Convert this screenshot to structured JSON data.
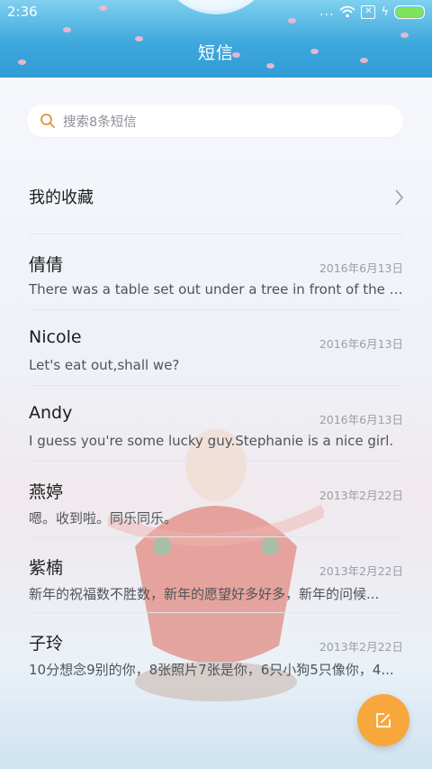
{
  "status_bar": {
    "time": "2:36",
    "signal": "...",
    "battery_color": "#7ee35c"
  },
  "header": {
    "title": "短信",
    "color": "#3fa8dc"
  },
  "search": {
    "placeholder": "搜索8条短信"
  },
  "favorites": {
    "label": "我的收藏"
  },
  "conversations": [
    {
      "name": "倩倩",
      "date": "2016年6月13日",
      "preview": "There was a table set out under a tree in front of the ho..."
    },
    {
      "name": "Nicole",
      "date": "2016年6月13日",
      "preview": "Let's eat out,shall we?"
    },
    {
      "name": "Andy",
      "date": "2016年6月13日",
      "preview": "I guess you're some lucky guy.Stephanie is a nice girl."
    },
    {
      "name": "燕婷",
      "date": "2013年2月22日",
      "preview": "嗯。收到啦。同乐同乐。"
    },
    {
      "name": "紫楠",
      "date": "2013年2月22日",
      "preview": "新年的祝福数不胜数，新年的愿望好多好多，新年的问候..."
    },
    {
      "name": "子玲",
      "date": "2013年2月22日",
      "preview": "10分想念9别的你，8张照片7张是你，6只小狗5只像你，4..."
    }
  ],
  "compose": {
    "icon": "compose-icon",
    "color": "#f7a73c"
  }
}
